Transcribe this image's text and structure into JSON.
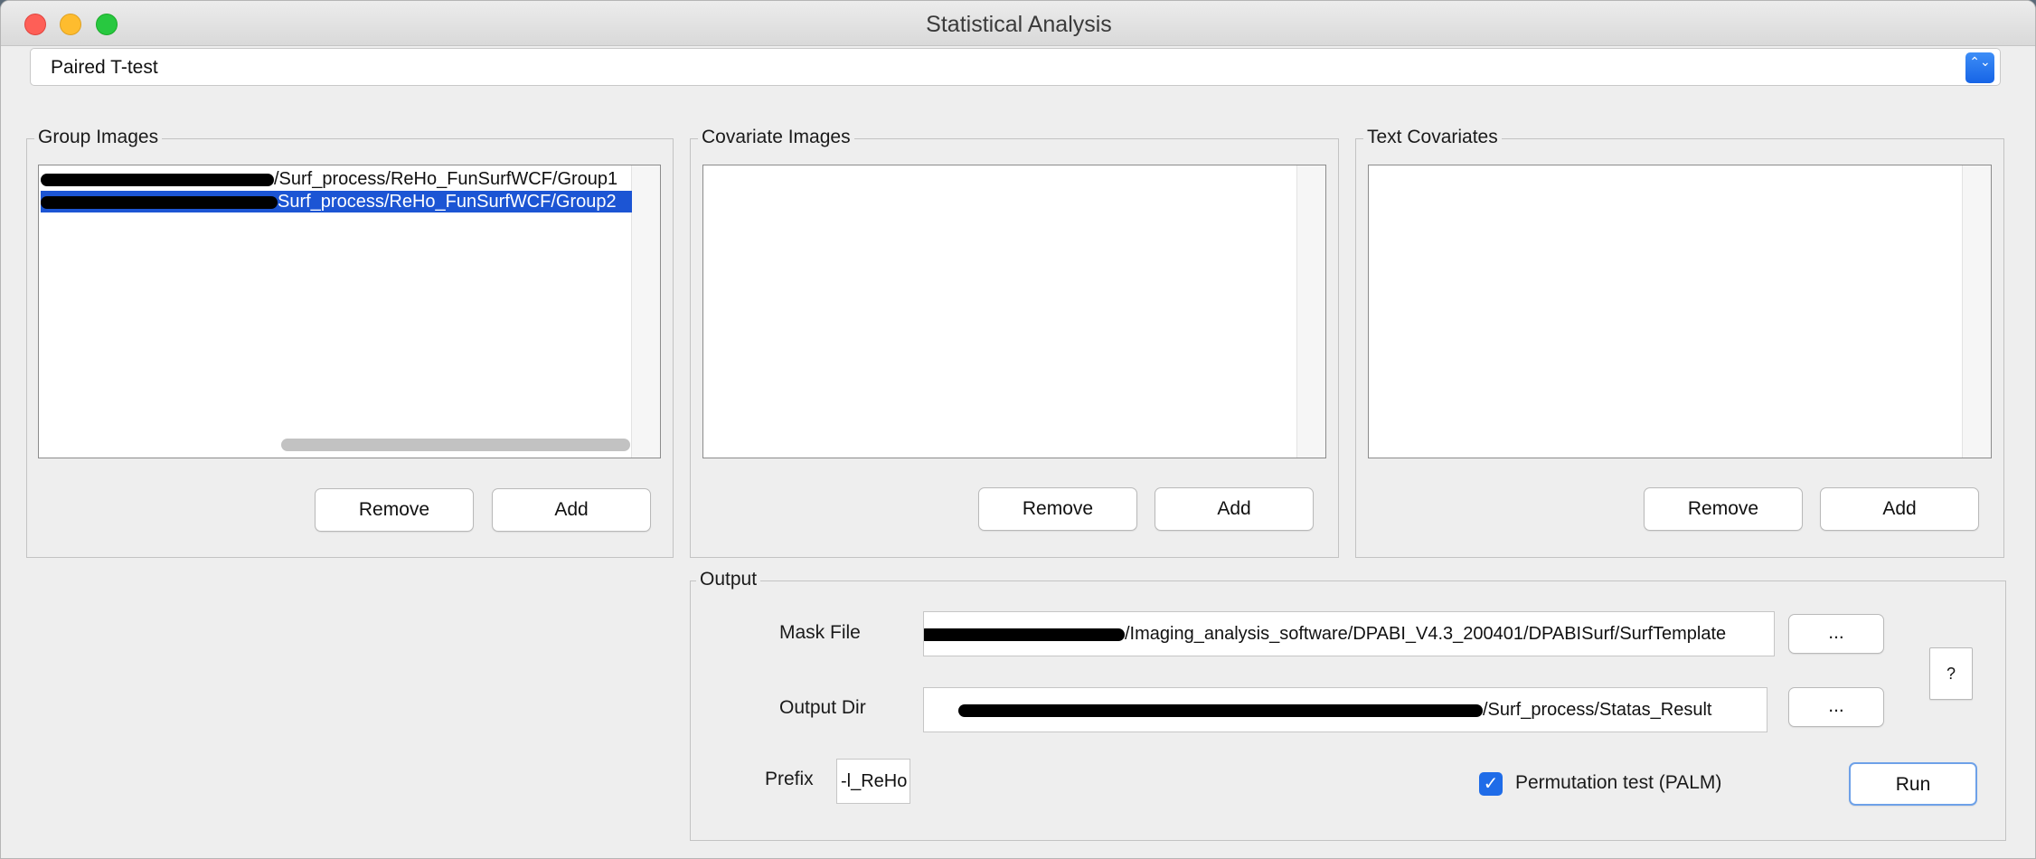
{
  "window": {
    "title": "Statistical Analysis"
  },
  "test_selector": {
    "selected": "Paired T-test",
    "arrow": "⌃⌄"
  },
  "group_images": {
    "legend": "Group Images",
    "items": [
      {
        "suffix": "/Surf_process/ReHo_FunSurfWCF/Group1",
        "selected": false
      },
      {
        "suffix": "Surf_process/ReHo_FunSurfWCF/Group2",
        "selected": true
      }
    ],
    "remove_label": "Remove",
    "add_label": "Add"
  },
  "covariate_images": {
    "legend": "Covariate Images",
    "remove_label": "Remove",
    "add_label": "Add"
  },
  "text_covariates": {
    "legend": "Text Covariates",
    "remove_label": "Remove",
    "add_label": "Add"
  },
  "output": {
    "legend": "Output",
    "mask_file_label": "Mask File",
    "mask_file_value": "/Imaging_analysis_software/DPABI_V4.3_200401/DPABISurf/SurfTemplate",
    "output_dir_label": "Output Dir",
    "output_dir_value": "/Surf_process/Statas_Result",
    "browse_label": "...",
    "help_label": "?",
    "prefix_label": "Prefix",
    "prefix_value": "-l_ReHo",
    "permutation_label": "Permutation test (PALM)",
    "permutation_checked": true,
    "check_glyph": "✓",
    "run_label": "Run"
  }
}
